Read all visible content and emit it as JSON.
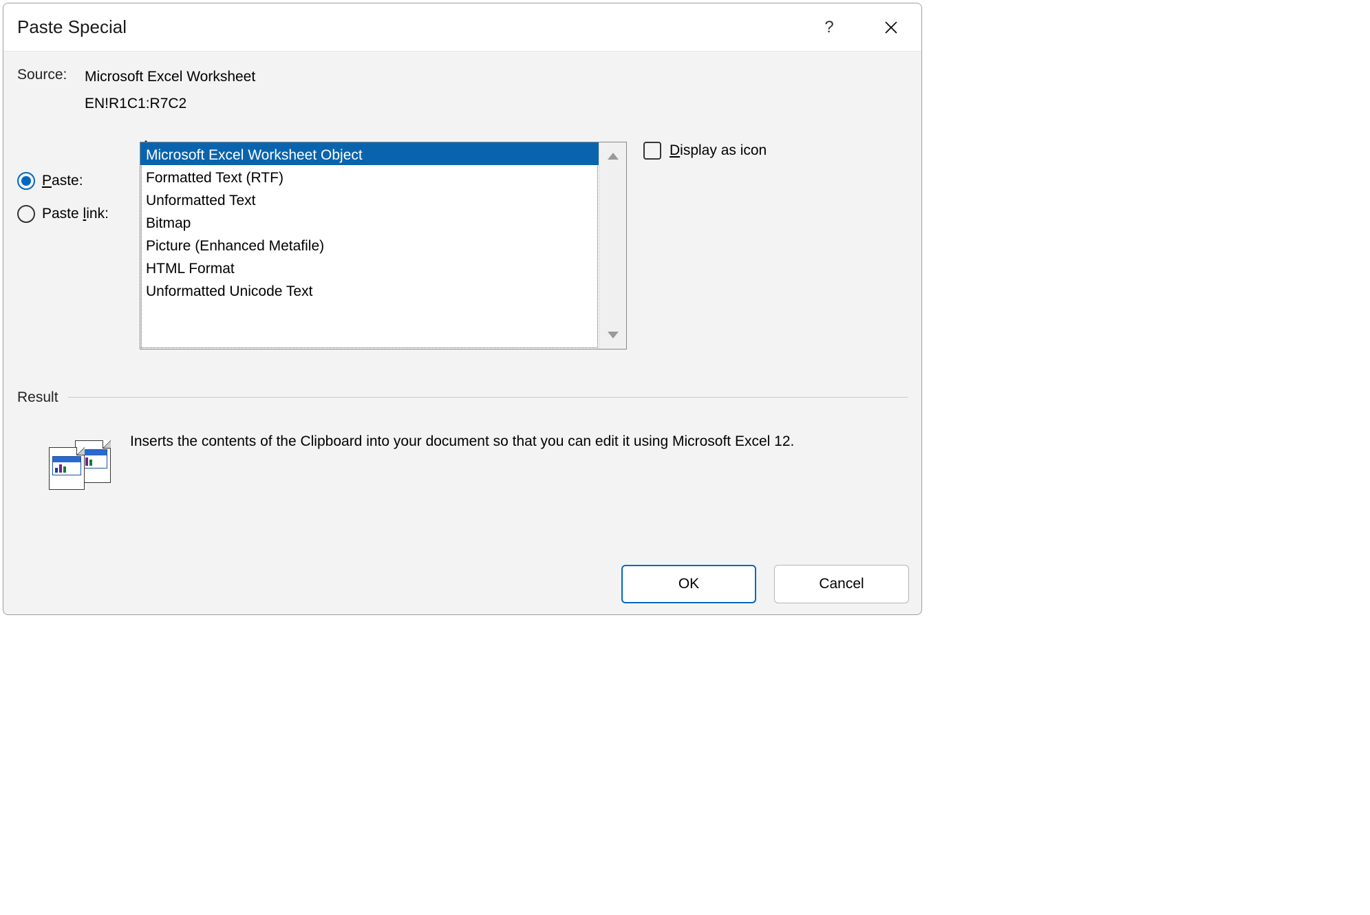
{
  "dialog": {
    "title": "Paste Special",
    "help": "?",
    "source_label": "Source:",
    "source_line1": "Microsoft Excel Worksheet",
    "source_line2": "EN!R1C1:R7C2",
    "as_label_pre": "A",
    "as_label_rest": "s:",
    "radios": {
      "paste_pre": "P",
      "paste_rest": "aste:",
      "paste_link_pre": "Paste ",
      "paste_link_u": "l",
      "paste_link_rest": "ink:",
      "selected": "paste"
    },
    "list": {
      "items": [
        "Microsoft Excel Worksheet Object",
        "Formatted Text (RTF)",
        "Unformatted Text",
        "Bitmap",
        "Picture (Enhanced Metafile)",
        "HTML Format",
        "Unformatted Unicode Text"
      ],
      "selected_index": 0
    },
    "display_as_icon_pre": "D",
    "display_as_icon_rest": "isplay as icon",
    "result": {
      "heading": "Result",
      "text": "Inserts the contents of the Clipboard into your document so that you can edit it using Microsoft Excel 12."
    },
    "buttons": {
      "ok": "OK",
      "cancel": "Cancel"
    }
  }
}
